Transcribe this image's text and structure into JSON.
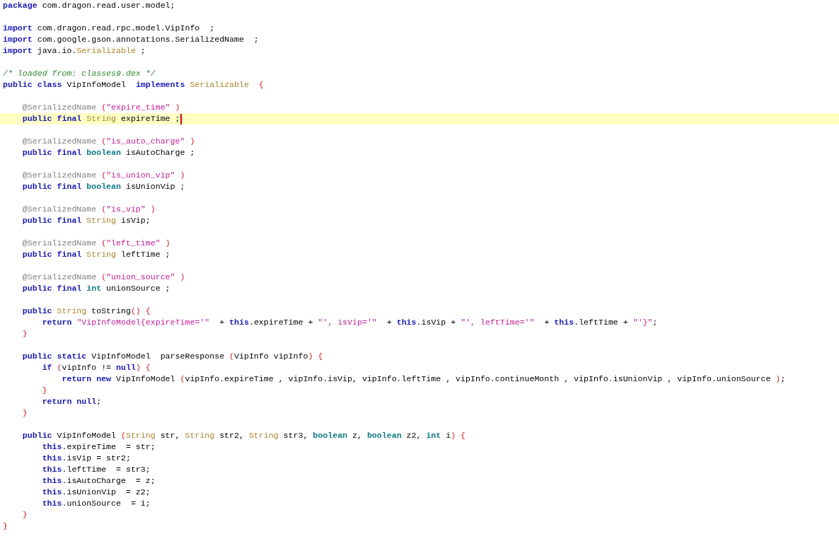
{
  "editor": {
    "blocks": [
      {
        "lines": [
          {
            "tokens": [
              {
                "kind": "keyword",
                "text": "package"
              },
              {
                "kind": "plain",
                "text": " com.dragon.read.user.model;"
              }
            ]
          }
        ]
      },
      {
        "lines": [
          {
            "tokens": [
              {
                "kind": "keyword",
                "text": "import"
              },
              {
                "kind": "plain",
                "text": " com.dragon.read.rpc.model.VipInfo  ;"
              }
            ]
          },
          {
            "tokens": [
              {
                "kind": "keyword",
                "text": "import"
              },
              {
                "kind": "plain",
                "text": " com.google.gson.annotations.SerializedName  ;"
              }
            ]
          },
          {
            "tokens": [
              {
                "kind": "keyword",
                "text": "import"
              },
              {
                "kind": "plain",
                "text": " java.io."
              },
              {
                "kind": "type",
                "text": "Serializable"
              },
              {
                "kind": "plain",
                "text": " ;"
              }
            ]
          }
        ]
      },
      {
        "lines": [
          {
            "tokens": [
              {
                "kind": "comment",
                "text": "/* loaded from: classes9.dex */"
              }
            ]
          },
          {
            "tokens": [
              {
                "kind": "keyword",
                "text": "public class"
              },
              {
                "kind": "plain",
                "text": " VipInfoModel  "
              },
              {
                "kind": "keyword",
                "text": "implements "
              },
              {
                "kind": "type",
                "text": "Serializable  "
              },
              {
                "kind": "bracket",
                "text": "{"
              }
            ]
          }
        ]
      },
      {
        "lines": [
          {
            "tokens": [
              {
                "kind": "annotation",
                "text": "    @SerializedName "
              },
              {
                "kind": "bracket",
                "text": "("
              },
              {
                "kind": "string",
                "text": "\"expire_time\" "
              },
              {
                "kind": "bracket",
                "text": ")"
              }
            ]
          },
          {
            "current": true,
            "tokens": [
              {
                "kind": "keyword",
                "text": "    public final "
              },
              {
                "kind": "type",
                "text": "String"
              },
              {
                "kind": "plain",
                "text": " expireTime ;"
              }
            ]
          }
        ]
      },
      {
        "lines": [
          {
            "tokens": [
              {
                "kind": "annotation",
                "text": "    @SerializedName "
              },
              {
                "kind": "bracket",
                "text": "("
              },
              {
                "kind": "string",
                "text": "\"is_auto_charge\" "
              },
              {
                "kind": "bracket",
                "text": ")"
              }
            ]
          },
          {
            "current": false,
            "tokens": [
              {
                "kind": "keyword",
                "text": "    public final "
              },
              {
                "kind": "primitive",
                "text": "boolean"
              },
              {
                "kind": "plain",
                "text": " isAutoCharge ;"
              }
            ]
          }
        ]
      },
      {
        "lines": [
          {
            "tokens": [
              {
                "kind": "annotation",
                "text": "    @SerializedName "
              },
              {
                "kind": "bracket",
                "text": "("
              },
              {
                "kind": "string",
                "text": "\"is_union_vip\" "
              },
              {
                "kind": "bracket",
                "text": ")"
              }
            ]
          },
          {
            "current": false,
            "tokens": [
              {
                "kind": "keyword",
                "text": "    public final "
              },
              {
                "kind": "primitive",
                "text": "boolean"
              },
              {
                "kind": "plain",
                "text": " isUnionVip ;"
              }
            ]
          }
        ]
      },
      {
        "lines": [
          {
            "tokens": [
              {
                "kind": "annotation",
                "text": "    @SerializedName "
              },
              {
                "kind": "bracket",
                "text": "("
              },
              {
                "kind": "string",
                "text": "\"is_vip\" "
              },
              {
                "kind": "bracket",
                "text": ")"
              }
            ]
          },
          {
            "current": false,
            "tokens": [
              {
                "kind": "keyword",
                "text": "    public final "
              },
              {
                "kind": "type",
                "text": "String"
              },
              {
                "kind": "plain",
                "text": " isVip;"
              }
            ]
          }
        ]
      },
      {
        "lines": [
          {
            "tokens": [
              {
                "kind": "annotation",
                "text": "    @SerializedName "
              },
              {
                "kind": "bracket",
                "text": "("
              },
              {
                "kind": "string",
                "text": "\"left_time\" "
              },
              {
                "kind": "bracket",
                "text": ")"
              }
            ]
          },
          {
            "current": false,
            "tokens": [
              {
                "kind": "keyword",
                "text": "    public final "
              },
              {
                "kind": "type",
                "text": "String"
              },
              {
                "kind": "plain",
                "text": " leftTime ;"
              }
            ]
          }
        ]
      },
      {
        "lines": [
          {
            "tokens": [
              {
                "kind": "annotation",
                "text": "    @SerializedName "
              },
              {
                "kind": "bracket",
                "text": "("
              },
              {
                "kind": "string",
                "text": "\"union_source\" "
              },
              {
                "kind": "bracket",
                "text": ")"
              }
            ]
          },
          {
            "current": false,
            "tokens": [
              {
                "kind": "keyword",
                "text": "    public final "
              },
              {
                "kind": "primitive",
                "text": "int"
              },
              {
                "kind": "plain",
                "text": " unionSource ;"
              }
            ]
          }
        ]
      },
      {
        "lines": [
          {
            "tokens": [
              {
                "kind": "keyword",
                "text": "    public "
              },
              {
                "kind": "type",
                "text": "String"
              },
              {
                "kind": "plain",
                "text": " toString"
              },
              {
                "kind": "bracket",
                "text": "() {"
              }
            ]
          },
          {
            "tokens": [
              {
                "kind": "keyword",
                "text": "        return "
              },
              {
                "kind": "string",
                "text": "\"VipInfoModel{expireTime='\""
              },
              {
                "kind": "plain",
                "text": "  + "
              },
              {
                "kind": "keyword",
                "text": "this"
              },
              {
                "kind": "plain",
                "text": ".expireTime + "
              },
              {
                "kind": "string",
                "text": "\"', isVip='\""
              },
              {
                "kind": "plain",
                "text": "  + "
              },
              {
                "kind": "keyword",
                "text": "this"
              },
              {
                "kind": "plain",
                "text": ".isVip + "
              },
              {
                "kind": "string",
                "text": "\"', leftTime='\""
              },
              {
                "kind": "plain",
                "text": "  + "
              },
              {
                "kind": "keyword",
                "text": "this"
              },
              {
                "kind": "plain",
                "text": ".leftTime + "
              },
              {
                "kind": "string",
                "text": "\"'}\""
              },
              {
                "kind": "plain",
                "text": ";"
              }
            ]
          },
          {
            "tokens": [
              {
                "kind": "bracket",
                "text": "    }"
              }
            ]
          }
        ]
      },
      {
        "lines": [
          {
            "tokens": [
              {
                "kind": "keyword",
                "text": "    public static"
              },
              {
                "kind": "plain",
                "text": " VipInfoModel  parseResponse "
              },
              {
                "kind": "bracket",
                "text": "("
              },
              {
                "kind": "plain",
                "text": "VipInfo vipInfo"
              },
              {
                "kind": "bracket",
                "text": ") {"
              }
            ]
          },
          {
            "tokens": [
              {
                "kind": "keyword",
                "text": "        if "
              },
              {
                "kind": "bracket",
                "text": "("
              },
              {
                "kind": "plain",
                "text": "vipInfo != "
              },
              {
                "kind": "keyword",
                "text": "null"
              },
              {
                "kind": "bracket",
                "text": ") {"
              }
            ]
          },
          {
            "tokens": [
              {
                "kind": "keyword",
                "text": "            return new"
              },
              {
                "kind": "plain",
                "text": " VipInfoModel "
              },
              {
                "kind": "bracket",
                "text": "("
              },
              {
                "kind": "plain",
                "text": "vipInfo.expireTime , vipInfo.isVip, vipInfo.leftTime , vipInfo.continueMonth , vipInfo.isUnionVip , vipInfo.unionSource "
              },
              {
                "kind": "bracket",
                "text": ")"
              },
              {
                "kind": "plain",
                "text": ";"
              }
            ]
          },
          {
            "tokens": [
              {
                "kind": "bracket",
                "text": "        }"
              }
            ]
          },
          {
            "tokens": [
              {
                "kind": "keyword",
                "text": "        return null"
              },
              {
                "kind": "plain",
                "text": ";"
              }
            ]
          },
          {
            "tokens": [
              {
                "kind": "bracket",
                "text": "    }"
              }
            ]
          }
        ]
      },
      {
        "lines": [
          {
            "tokens": [
              {
                "kind": "keyword",
                "text": "    public"
              },
              {
                "kind": "plain",
                "text": " VipInfoModel "
              },
              {
                "kind": "bracket",
                "text": "("
              },
              {
                "kind": "type",
                "text": "String"
              },
              {
                "kind": "plain",
                "text": " str, "
              },
              {
                "kind": "type",
                "text": "String"
              },
              {
                "kind": "plain",
                "text": " str2, "
              },
              {
                "kind": "type",
                "text": "String"
              },
              {
                "kind": "plain",
                "text": " str3, "
              },
              {
                "kind": "primitive",
                "text": "boolean"
              },
              {
                "kind": "plain",
                "text": " z, "
              },
              {
                "kind": "primitive",
                "text": "boolean"
              },
              {
                "kind": "plain",
                "text": " z2, "
              },
              {
                "kind": "primitive",
                "text": "int"
              },
              {
                "kind": "plain",
                "text": " i"
              },
              {
                "kind": "bracket",
                "text": ") {"
              }
            ]
          },
          {
            "tokens": [
              {
                "kind": "keyword",
                "text": "        this"
              },
              {
                "kind": "plain",
                "text": ".expireTime  = str;"
              }
            ]
          },
          {
            "tokens": [
              {
                "kind": "keyword",
                "text": "        this"
              },
              {
                "kind": "plain",
                "text": ".isVip = str2;"
              }
            ]
          },
          {
            "tokens": [
              {
                "kind": "keyword",
                "text": "        this"
              },
              {
                "kind": "plain",
                "text": ".leftTime  = str3;"
              }
            ]
          },
          {
            "tokens": [
              {
                "kind": "keyword",
                "text": "        this"
              },
              {
                "kind": "plain",
                "text": ".isAutoCharge  = z;"
              }
            ]
          },
          {
            "tokens": [
              {
                "kind": "keyword",
                "text": "        this"
              },
              {
                "kind": "plain",
                "text": ".isUnionVip  = z2;"
              }
            ]
          },
          {
            "tokens": [
              {
                "kind": "keyword",
                "text": "        this"
              },
              {
                "kind": "plain",
                "text": ".unionSource  = i;"
              }
            ]
          },
          {
            "tokens": [
              {
                "kind": "bracket",
                "text": "    }"
              }
            ]
          },
          {
            "tokens": [
              {
                "kind": "bracket",
                "text": "}"
              }
            ]
          }
        ]
      }
    ]
  }
}
